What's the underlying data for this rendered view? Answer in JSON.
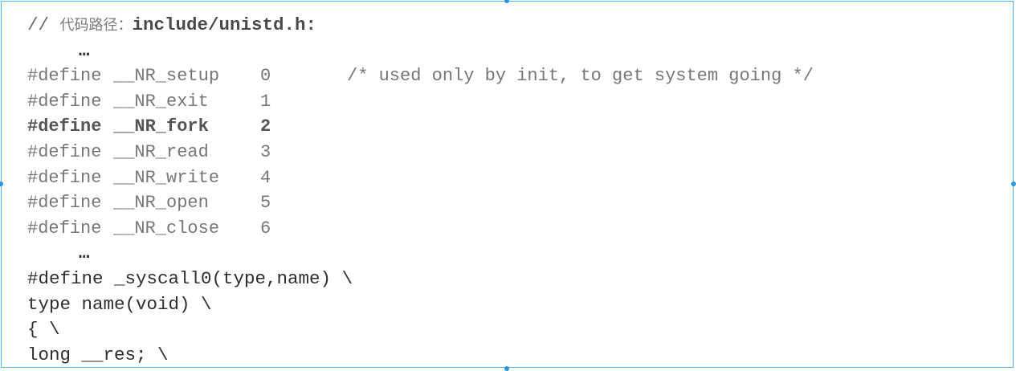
{
  "header": {
    "comment_prefix": "// ",
    "label_cn": "代码路径：",
    "path": "include/unistd.h:"
  },
  "ellipsis": "…",
  "defines": [
    {
      "keyword": "#define",
      "name": "__NR_setup",
      "value": "0",
      "comment": "/* used only by init, to get system going */"
    },
    {
      "keyword": "#define",
      "name": "__NR_exit",
      "value": "1",
      "comment": ""
    },
    {
      "keyword": "#define",
      "name": "__NR_fork",
      "value": "2",
      "comment": ""
    },
    {
      "keyword": "#define",
      "name": "__NR_read",
      "value": "3",
      "comment": ""
    },
    {
      "keyword": "#define",
      "name": "__NR_write",
      "value": "4",
      "comment": ""
    },
    {
      "keyword": "#define",
      "name": "__NR_open",
      "value": "5",
      "comment": ""
    },
    {
      "keyword": "#define",
      "name": "__NR_close",
      "value": "6",
      "comment": ""
    }
  ],
  "macro_lines": [
    "#define _syscall0(type,name) \\",
    "type name(void) \\",
    "{ \\",
    "long __res; \\"
  ],
  "colors": {
    "frame_border": "#56b5e8",
    "handle": "#2a96dc"
  }
}
